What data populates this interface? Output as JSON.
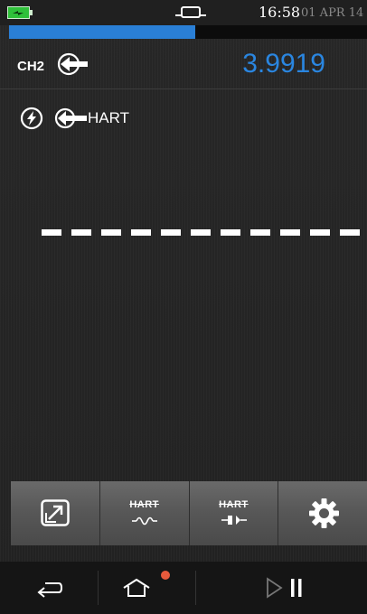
{
  "status": {
    "time": "16:58",
    "date": "01 APR 14",
    "progress_fraction": 0.52
  },
  "channel": {
    "label": "CH2",
    "value": "3.9919",
    "value_color": "#2a86e0"
  },
  "hart_row": {
    "label": "HART"
  },
  "toolbar": {
    "hart_wave_label": "HART",
    "hart_plug_label": "HART"
  },
  "colors": {
    "accent": "#2a7fd6",
    "notification": "#e85a3c",
    "battery": "#2fc03a"
  },
  "icons": [
    "battery-icon",
    "device-icon",
    "arrow-left-icon",
    "lightning-icon",
    "expand-icon",
    "hart-wave-icon",
    "hart-plug-icon",
    "gear-icon",
    "back-icon",
    "home-icon",
    "play-pause-icon"
  ]
}
